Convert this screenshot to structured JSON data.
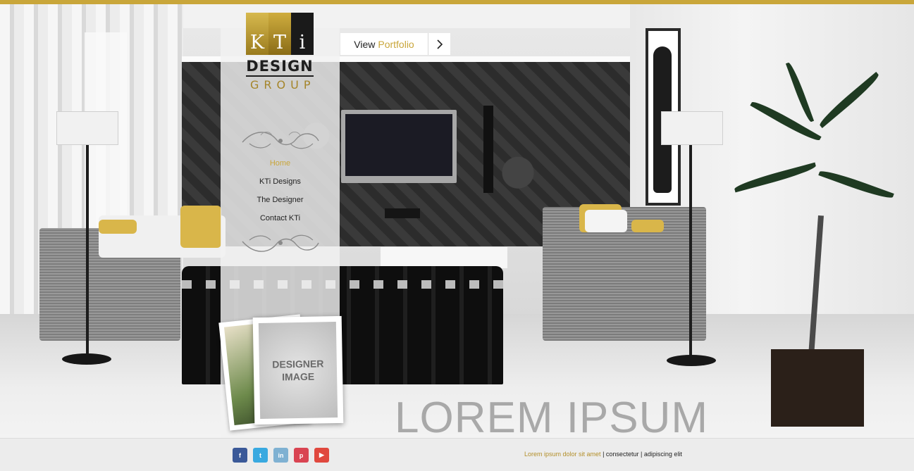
{
  "brand": {
    "letters": [
      "K",
      "T",
      "i"
    ],
    "design": "DESIGN",
    "group": "GROUP",
    "colors": {
      "gold": "#c9a63a",
      "dark": "#1a1a1a"
    }
  },
  "nav": {
    "items": [
      {
        "label": "Home",
        "active": true
      },
      {
        "label": "KTi Designs",
        "active": false
      },
      {
        "label": "The Designer",
        "active": false
      },
      {
        "label": "Contact KTi",
        "active": false
      }
    ]
  },
  "portfolio_button": {
    "label_prefix": "View",
    "label_accent": "Portfolio",
    "icon": "chevron-right-icon"
  },
  "designer_photo": {
    "line1": "DESIGNER",
    "line2": "IMAGE"
  },
  "watermark": "LOREM IPSUM",
  "footer": {
    "social": [
      {
        "name": "facebook-icon",
        "glyph": "f",
        "color": "#3b5998"
      },
      {
        "name": "twitter-icon",
        "glyph": "t",
        "color": "#39a9e0"
      },
      {
        "name": "linkedin-icon",
        "glyph": "in",
        "color": "#7fb1d2"
      },
      {
        "name": "pinterest-icon",
        "glyph": "p",
        "color": "#d94452"
      },
      {
        "name": "youtube-icon",
        "glyph": "▶",
        "color": "#e0483e"
      }
    ],
    "text_accent": "Lorem ipsum dolor sit amet",
    "separator": "|",
    "text_part2": "consectetur",
    "text_part3": "adipiscing elit"
  }
}
